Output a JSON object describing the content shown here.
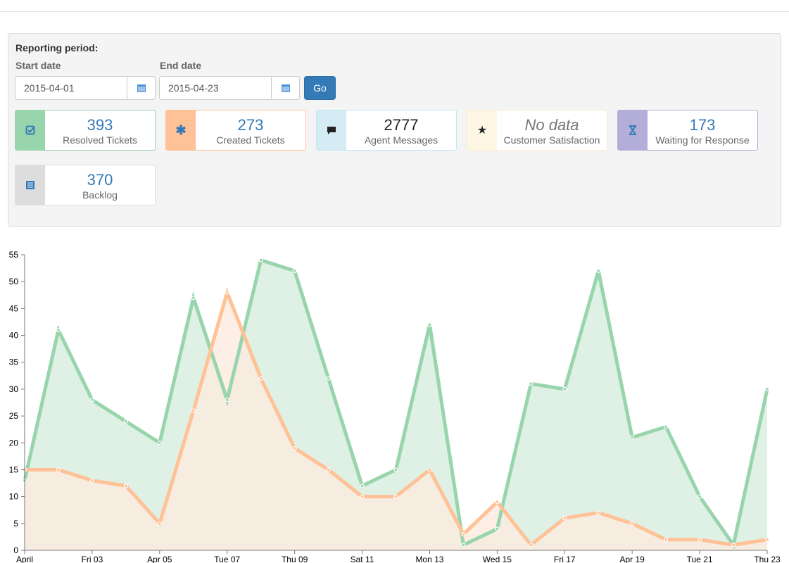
{
  "filter": {
    "title": "Reporting period:",
    "start_label": "Start date",
    "start_value": "2015-04-01",
    "end_label": "End date",
    "end_value": "2015-04-23",
    "go_label": "Go"
  },
  "cards": [
    {
      "value": "393",
      "label": "Resolved Tickets",
      "icon": "check-square-icon",
      "color": "#98d4ac",
      "border": "#98d4ac"
    },
    {
      "value": "273",
      "label": "Created Tickets",
      "icon": "asterisk-icon",
      "color": "#ffc196",
      "border": "#ffc196"
    },
    {
      "value": "2777",
      "label": "Agent Messages",
      "icon": "comment-icon",
      "color": "#d6ecf5",
      "border": "#bce8f1"
    },
    {
      "value": "No data",
      "label": "Customer Satisfaction",
      "icon": "star-icon",
      "color": "#fdf6e3",
      "border": "#faebcc"
    },
    {
      "value": "173",
      "label": "Waiting for Response",
      "icon": "hourglass-icon",
      "color": "#b3add9",
      "border": "#b3add9"
    },
    {
      "value": "370",
      "label": "Backlog",
      "icon": "list-icon",
      "color": "#dddddd",
      "border": "#dddddd"
    }
  ],
  "chart_data": {
    "type": "area",
    "ylim": [
      0,
      55
    ],
    "yticks": [
      0,
      5,
      10,
      15,
      20,
      25,
      30,
      35,
      40,
      45,
      50,
      55
    ],
    "x_tick_labels": [
      "April",
      "Fri 03",
      "Apr 05",
      "Tue 07",
      "Thu 09",
      "Sat 11",
      "Mon 13",
      "Wed 15",
      "Fri 17",
      "Apr 19",
      "Tue 21",
      "Thu 23"
    ],
    "x": [
      "2015-04-01",
      "2015-04-02",
      "2015-04-03",
      "2015-04-04",
      "2015-04-05",
      "2015-04-06",
      "2015-04-07",
      "2015-04-08",
      "2015-04-09",
      "2015-04-10",
      "2015-04-11",
      "2015-04-12",
      "2015-04-13",
      "2015-04-14",
      "2015-04-15",
      "2015-04-16",
      "2015-04-17",
      "2015-04-18",
      "2015-04-19",
      "2015-04-20",
      "2015-04-21",
      "2015-04-22",
      "2015-04-23"
    ],
    "series": [
      {
        "color": "#98d4ac",
        "fill": "#dff1e5",
        "values": [
          13,
          41,
          28,
          24,
          20,
          47,
          28,
          54,
          52,
          32,
          12,
          15,
          42,
          1,
          4,
          31,
          30,
          52,
          21,
          23,
          10,
          1,
          30
        ]
      },
      {
        "color": "#ffc196",
        "fill": "#fde9dd",
        "values": [
          15,
          15,
          13,
          12,
          5,
          26,
          48,
          32,
          19,
          15,
          10,
          10,
          15,
          3,
          9,
          1,
          6,
          7,
          5,
          2,
          2,
          1,
          2
        ]
      }
    ]
  }
}
